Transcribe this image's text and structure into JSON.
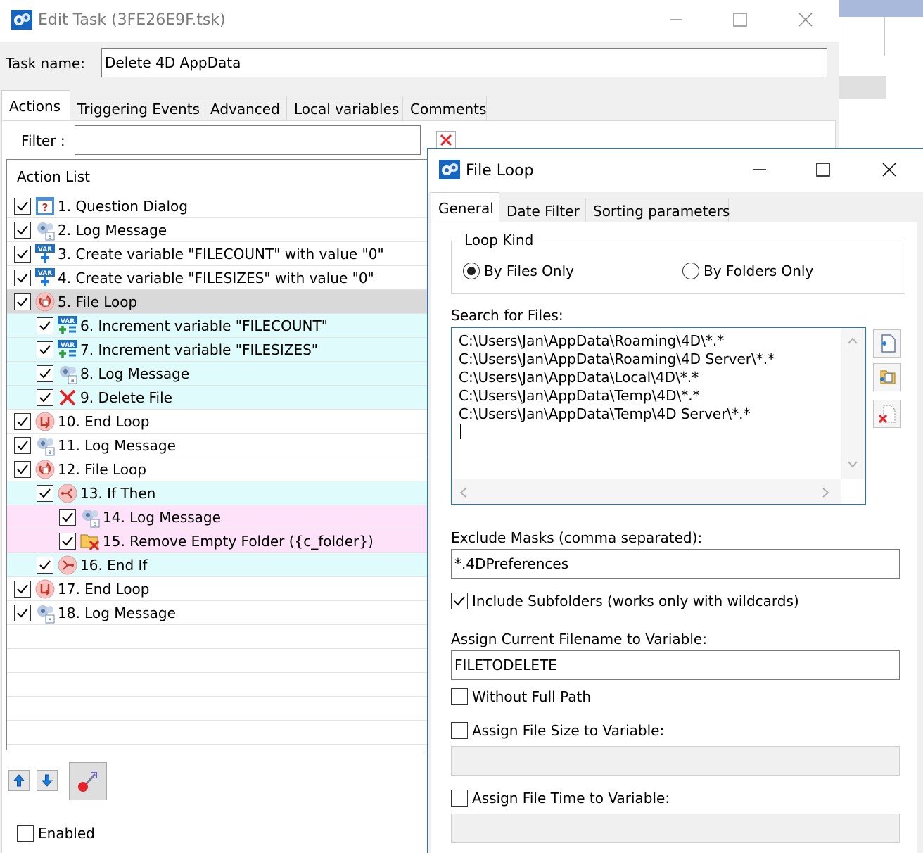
{
  "main_window": {
    "title": "Edit Task (3FE26E9F.tsk)",
    "task_name_label": "Task name:",
    "task_name_value": "Delete 4D AppData",
    "tabs": [
      "Actions",
      "Triggering Events",
      "Advanced",
      "Local variables",
      "Comments"
    ],
    "filter_label": "Filter :",
    "filter_value": "",
    "action_list_header": "Action List",
    "actions": [
      {
        "label": "1. Question Dialog",
        "icon": "question-dialog-icon",
        "indent": 0,
        "style": "normal"
      },
      {
        "label": "2. Log Message",
        "icon": "log-message-icon",
        "indent": 0,
        "style": "normal"
      },
      {
        "label": "3. Create variable \"FILECOUNT\" with value \"0\"",
        "icon": "create-variable-icon",
        "indent": 0,
        "style": "normal"
      },
      {
        "label": "4. Create variable \"FILESIZES\" with value \"0\"",
        "icon": "create-variable-icon",
        "indent": 0,
        "style": "normal"
      },
      {
        "label": "5. File Loop",
        "icon": "file-loop-icon",
        "indent": 0,
        "style": "selected"
      },
      {
        "label": "6. Increment variable \"FILECOUNT\"",
        "icon": "increment-variable-icon",
        "indent": 1,
        "style": "cyan"
      },
      {
        "label": "7. Increment variable \"FILESIZES\"",
        "icon": "increment-variable-icon",
        "indent": 1,
        "style": "cyan"
      },
      {
        "label": "8. Log Message",
        "icon": "log-message-icon",
        "indent": 1,
        "style": "cyan"
      },
      {
        "label": "9. Delete File",
        "icon": "delete-file-icon",
        "indent": 1,
        "style": "cyan"
      },
      {
        "label": "10. End Loop",
        "icon": "end-loop-icon",
        "indent": 0,
        "style": "normal"
      },
      {
        "label": "11. Log Message",
        "icon": "log-message-icon",
        "indent": 0,
        "style": "normal"
      },
      {
        "label": "12. File Loop",
        "icon": "file-loop-icon",
        "indent": 0,
        "style": "normal"
      },
      {
        "label": "13. If Then",
        "icon": "if-then-icon",
        "indent": 1,
        "style": "cyan"
      },
      {
        "label": "14. Log Message",
        "icon": "log-message-icon",
        "indent": 2,
        "style": "pink"
      },
      {
        "label": "15. Remove Empty Folder ({c_folder})",
        "icon": "remove-folder-icon",
        "indent": 2,
        "style": "pink"
      },
      {
        "label": "16. End If",
        "icon": "end-if-icon",
        "indent": 1,
        "style": "cyan"
      },
      {
        "label": "17. End Loop",
        "icon": "end-loop-icon",
        "indent": 0,
        "style": "normal"
      },
      {
        "label": "18. Log Message",
        "icon": "log-message-icon",
        "indent": 0,
        "style": "normal"
      }
    ],
    "enabled_label": "Enabled"
  },
  "dialog": {
    "title": "File Loop",
    "tabs": [
      "General",
      "Date Filter",
      "Sorting parameters"
    ],
    "loop_kind_label": "Loop Kind",
    "radio_files": "By Files Only",
    "radio_folders": "By Folders Only",
    "selected_radio": "By Files Only",
    "search_label": "Search for Files:",
    "search_lines": [
      "C:\\Users\\Jan\\AppData\\Roaming\\4D\\*.*",
      "C:\\Users\\Jan\\AppData\\Roaming\\4D Server\\*.*",
      "C:\\Users\\Jan\\AppData\\Local\\4D\\*.*",
      "C:\\Users\\Jan\\AppData\\Temp\\4D\\*.*",
      "C:\\Users\\Jan\\AppData\\Temp\\4D Server\\*.*"
    ],
    "exclude_label": "Exclude Masks (comma separated):",
    "exclude_value": "*.4DPreferences",
    "include_subfolders_label": "Include Subfolders (works only with wildcards)",
    "include_subfolders_checked": true,
    "assign_filename_label": "Assign Current Filename to Variable:",
    "assign_filename_value": "FILETODELETE",
    "without_full_path_label": "Without Full Path",
    "assign_size_label": "Assign File Size to Variable:",
    "assign_time_label": "Assign File Time to Variable:"
  },
  "colors": {
    "accent_border": "#1979ca",
    "row_selected": "#d9d9d9",
    "row_cyan": "#e0fbfb",
    "row_pink": "#fde2fa",
    "title_inactive": "#7a7a7a"
  }
}
